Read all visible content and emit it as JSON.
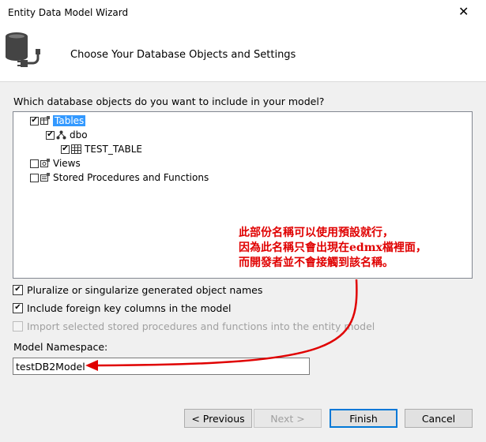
{
  "window": {
    "title": "Entity Data Model Wizard",
    "close_glyph": "✕"
  },
  "header": {
    "heading": "Choose Your Database Objects and Settings",
    "icon": "database-plug-icon"
  },
  "prompt": "Which database objects do you want to include in your model?",
  "tree": {
    "tables": {
      "label": "Tables",
      "checked": true,
      "selected": true
    },
    "schema": {
      "label": "dbo",
      "checked": true
    },
    "table": {
      "label": "TEST_TABLE",
      "checked": true
    },
    "views": {
      "label": "Views",
      "checked": false
    },
    "procs": {
      "label": "Stored Procedures and Functions",
      "checked": false
    }
  },
  "annotation": {
    "line1": "此部份名稱可以使用預設就行，",
    "line2": "因為此名稱只會出現在edmx檔裡面，",
    "line3": "而開發者並不會接觸到該名稱。",
    "color": "#e00000"
  },
  "options": {
    "pluralize": {
      "label": "Pluralize or singularize generated object names",
      "checked": true
    },
    "foreign_keys": {
      "label": "Include foreign key columns in the model",
      "checked": true
    },
    "import_procs": {
      "label": "Import selected stored procedures and functions into the entity model",
      "checked": false,
      "enabled": false
    }
  },
  "namespace": {
    "label": "Model Namespace:",
    "value": "testDB2Model"
  },
  "buttons": {
    "previous": "< Previous",
    "next": "Next >",
    "finish": "Finish",
    "cancel": "Cancel"
  },
  "colors": {
    "accent": "#0078d7",
    "selection": "#3399ff"
  }
}
